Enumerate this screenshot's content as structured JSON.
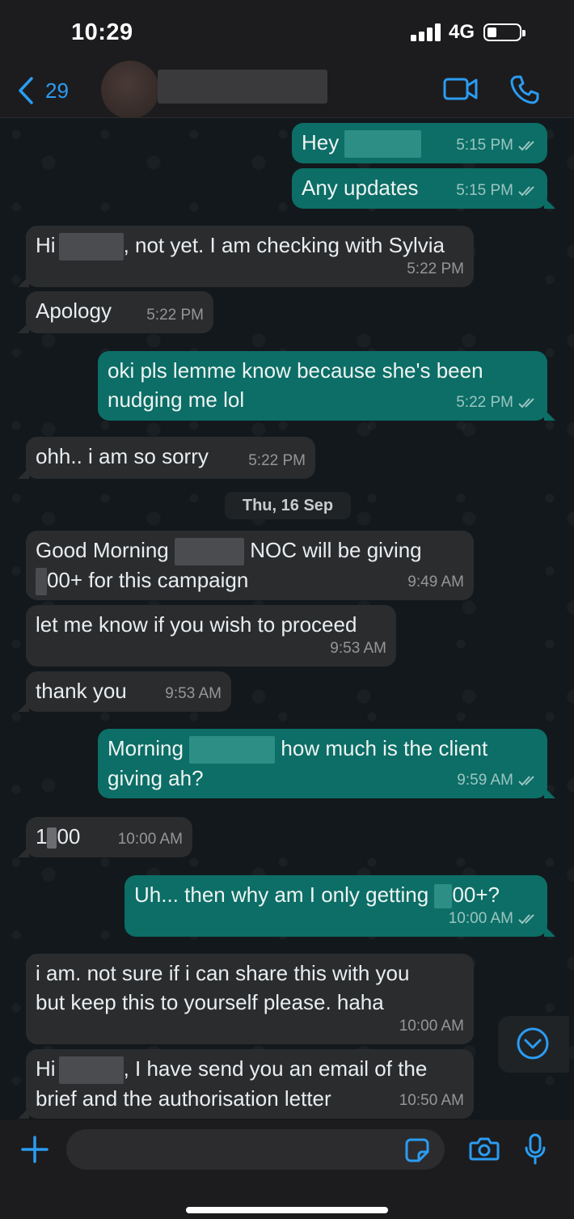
{
  "status_bar": {
    "time": "10:29",
    "network": "4G"
  },
  "header": {
    "back_count": "29"
  },
  "date_separator": "Thu, 16 Sep",
  "messages": [
    {
      "dir": "out",
      "parts": [
        "Hey"
      ],
      "time": "5:15 PM",
      "ticks": true
    },
    {
      "dir": "out",
      "parts": [
        "Any updates"
      ],
      "time": "5:15 PM",
      "ticks": true
    },
    {
      "dir": "in",
      "parts": [
        "Hi",
        ", not yet. I am checking with Sylvia"
      ],
      "time": "5:22 PM"
    },
    {
      "dir": "in",
      "parts": [
        "Apology"
      ],
      "time": "5:22 PM"
    },
    {
      "dir": "out",
      "parts": [
        "oki pls lemme know because she's been",
        "nudging me lol"
      ],
      "time": "5:22 PM",
      "ticks": true
    },
    {
      "dir": "in",
      "parts": [
        "ohh.. i am so sorry"
      ],
      "time": "5:22 PM"
    },
    {
      "dir": "in",
      "parts": [
        "Good Morning",
        "NOC will be giving",
        "00+ for this campaign"
      ],
      "time": "9:49 AM"
    },
    {
      "dir": "in",
      "parts": [
        "let me know if you wish to proceed"
      ],
      "time": "9:53 AM"
    },
    {
      "dir": "in",
      "parts": [
        "thank you"
      ],
      "time": "9:53 AM"
    },
    {
      "dir": "out",
      "parts": [
        "Morning",
        "how much is the client",
        "giving ah?"
      ],
      "time": "9:59 AM",
      "ticks": true
    },
    {
      "dir": "in",
      "parts": [
        "1",
        "00"
      ],
      "time": "10:00 AM"
    },
    {
      "dir": "out",
      "parts": [
        "Uh... then why am I only getting",
        "00+?"
      ],
      "time": "10:00 AM",
      "ticks": true
    },
    {
      "dir": "in",
      "parts": [
        "i am. not sure if i can share this with you",
        "but keep this to yourself please. haha"
      ],
      "time": "10:00 AM"
    },
    {
      "dir": "in",
      "parts": [
        "Hi",
        ", I have send you an email of the",
        "brief and the authorisation letter"
      ],
      "time": "10:50 AM"
    }
  ],
  "input": {
    "placeholder": ""
  }
}
